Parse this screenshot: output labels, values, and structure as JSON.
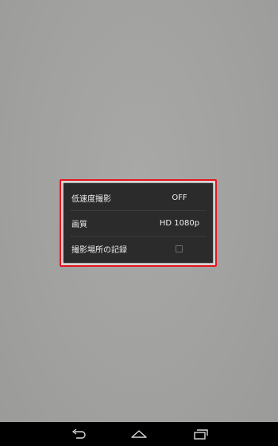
{
  "settings": {
    "rows": [
      {
        "label": "低速度撮影",
        "value": "OFF"
      },
      {
        "label": "画質",
        "value": "HD 1080p"
      },
      {
        "label": "撮影場所の記録",
        "checked": false
      }
    ]
  },
  "navbar": {
    "buttons": [
      "back-icon",
      "home-icon",
      "recents-icon"
    ]
  },
  "colors": {
    "highlight": "#e8141c",
    "panel": "#2b2b2b",
    "navbar": "#000000"
  }
}
